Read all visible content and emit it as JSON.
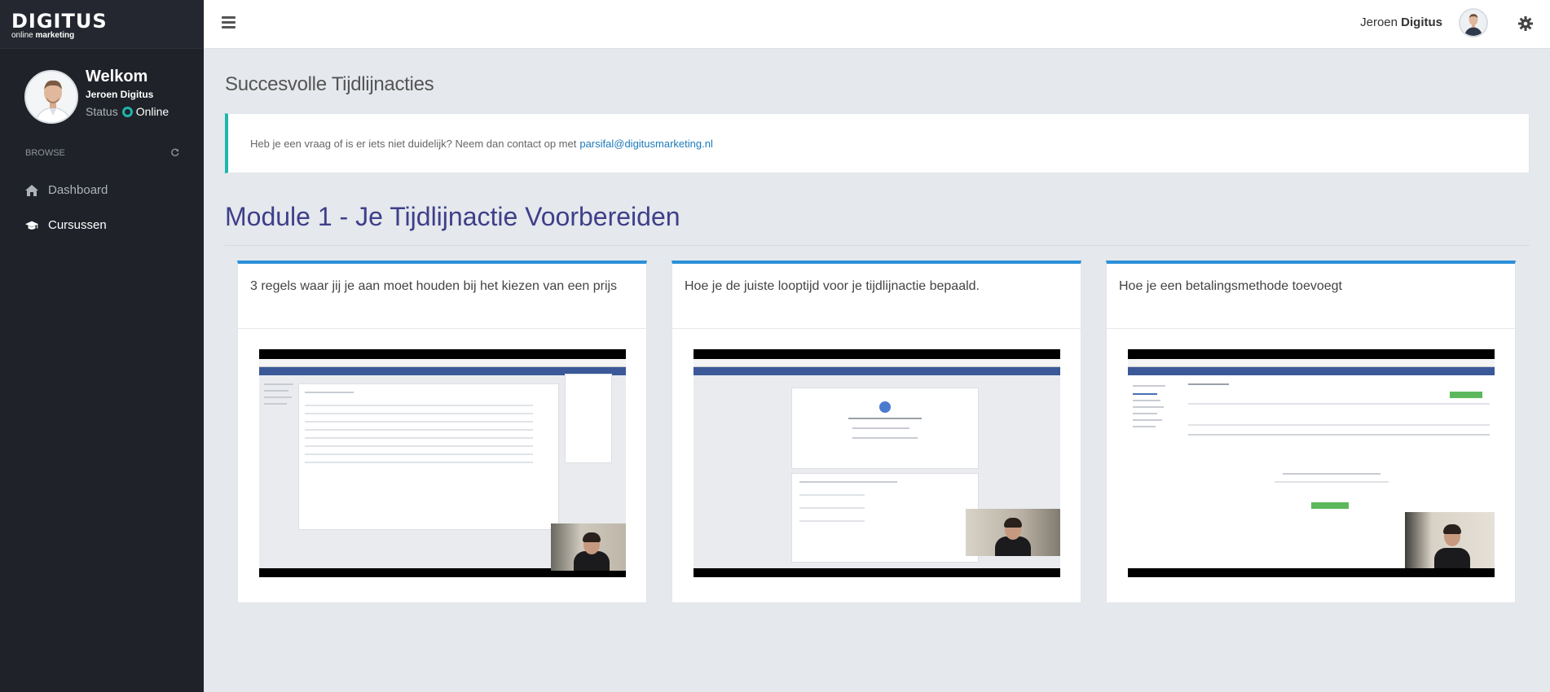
{
  "logo": {
    "main": "DIGITUS",
    "sub_prefix": "online",
    "sub_bold": "marketing"
  },
  "sidebar": {
    "welcome": "Welkom",
    "user_name": "Jeroen Digitus",
    "status_label": "Status",
    "status_value": "Online",
    "browse_label": "BROWSE",
    "items": [
      {
        "label": "Dashboard",
        "icon": "home-icon"
      },
      {
        "label": "Cursussen",
        "icon": "graduation-cap-icon"
      }
    ]
  },
  "header": {
    "user_first": "Jeroen",
    "user_last": "Digitus"
  },
  "main": {
    "page_title": "Succesvolle Tijdlijnacties",
    "alert_text": "Heb je een vraag of is er iets niet duidelijk? Neem dan contact op met",
    "alert_email": "parsifal@digitusmarketing.nl",
    "module_title": "Module 1 - Je Tijdlijnactie Voorbereiden",
    "cards": [
      {
        "title": "3 regels waar jij je aan moet houden bij het kiezen van een prijs"
      },
      {
        "title": "Hoe je de juiste looptijd voor je tijdlijnactie bepaald."
      },
      {
        "title": "Hoe je een betalingsmethode toevoegt"
      }
    ]
  },
  "colors": {
    "sidebar_bg": "#1f2229",
    "accent_teal": "#1fb5ad",
    "card_top_border": "#2b8fd8",
    "module_title": "#3e3f8a",
    "link": "#1d7abc"
  }
}
